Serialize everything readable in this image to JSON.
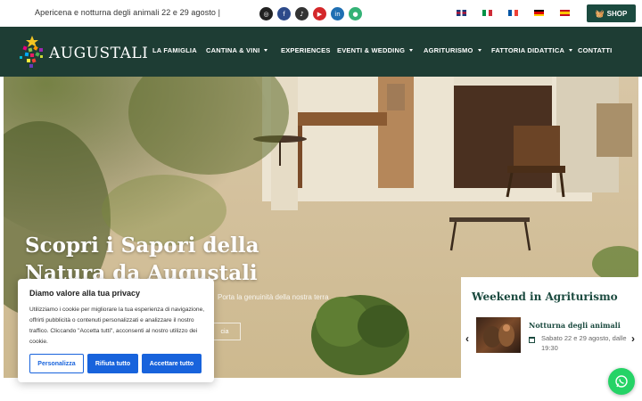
{
  "topbar": {
    "announcement": "Apericena e notturna degli animali 22 e 29 agosto |",
    "social": [
      "instagram-icon",
      "facebook-icon",
      "tiktok-icon",
      "youtube-icon",
      "linkedin-icon",
      "tripadvisor-icon"
    ],
    "social_colors": [
      "#222222",
      "#2d4a8a",
      "#333333",
      "#d4272a",
      "#1f6fb2",
      "#34b276"
    ],
    "languages": [
      "English",
      "Italiano",
      "Français",
      "Deutsch",
      "Español"
    ],
    "shop_label": "SHOP"
  },
  "nav": {
    "logo_text": "AUGUSTALI",
    "items": [
      {
        "label": "LA FAMIGLIA",
        "dropdown": false
      },
      {
        "label": "CANTINA & VINI",
        "dropdown": true
      },
      {
        "label": "EXPERIENCES",
        "dropdown": false
      },
      {
        "label": "EVENTI & WEDDING",
        "dropdown": true
      },
      {
        "label": "AGRITURISMO",
        "dropdown": true
      },
      {
        "label": "FATTORIA DIDATTICA",
        "dropdown": true
      },
      {
        "label": "CONTATTI",
        "dropdown": false
      }
    ]
  },
  "hero": {
    "title": "Scopri i Sapori della Natura da Augustali",
    "subtitle": "Porta la genuinità della nostra terra",
    "button_label": "cia"
  },
  "event_card": {
    "title": "Weekend in Agriturismo",
    "event_name": "Notturna degli animali",
    "event_date": "Sabato 22 e 29 agosto, dalle 19:30"
  },
  "cookie_banner": {
    "title": "Diamo valore alla tua privacy",
    "text": "Utilizziamo i cookie per migliorare la tua esperienza di navigazione, offrirti pubblicità o contenuti personalizzati e analizzare il nostro traffico. Cliccando \"Accetta tutti\", acconsenti al nostro utilizzo dei cookie.",
    "customize_label": "Personalizza",
    "reject_label": "Rifiuta tutto",
    "accept_label": "Accettare tutto"
  },
  "colors": {
    "brand_green": "#1e3d34",
    "accent_blue": "#1863dc",
    "whatsapp_green": "#25d366"
  }
}
